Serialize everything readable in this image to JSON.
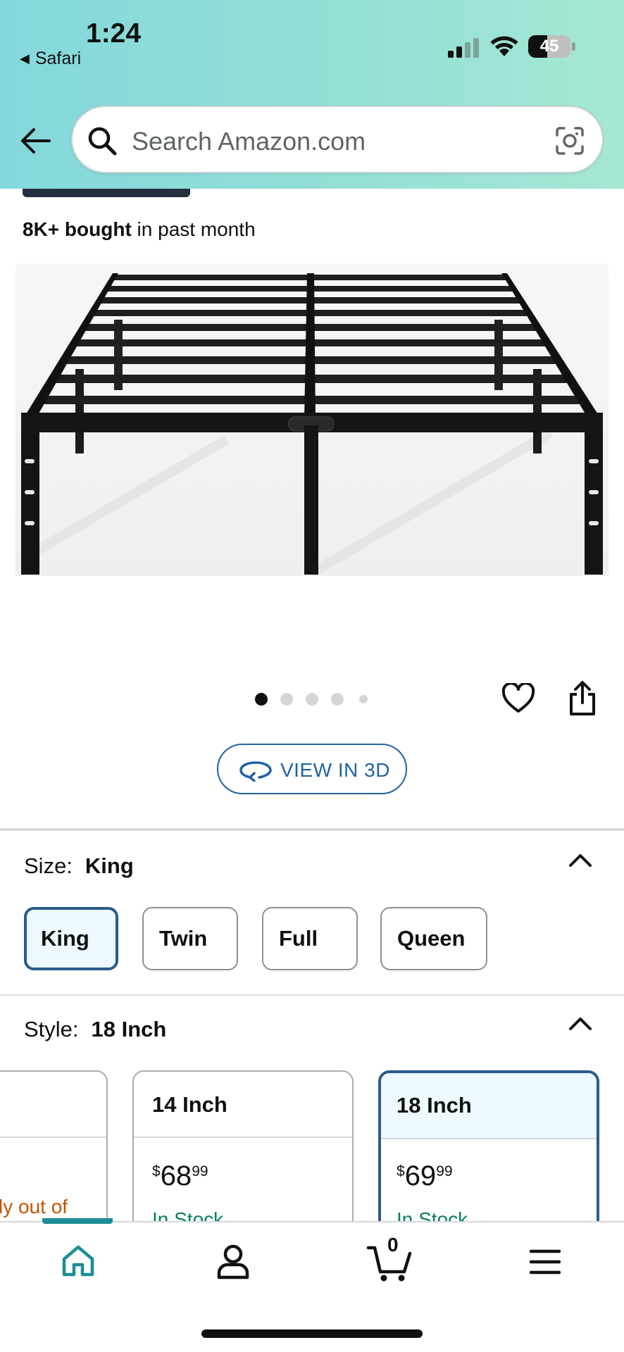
{
  "status_bar": {
    "time": "1:24",
    "back_app": "Safari",
    "battery": "45"
  },
  "search": {
    "placeholder": "Search Amazon.com"
  },
  "product": {
    "bought_bold": "8K+ bought",
    "bought_rest": " in past month",
    "image_count": 5,
    "active_image": 1
  },
  "view3d": {
    "label": "VIEW IN 3D"
  },
  "size": {
    "label": "Size:",
    "selected": "King",
    "options": [
      "King",
      "Twin",
      "Full",
      "Queen"
    ]
  },
  "style": {
    "label": "Style:",
    "selected": "18 Inch",
    "partial_card_text": "ly out of",
    "cards": [
      {
        "name": "14 Inch",
        "price_symbol": "$",
        "price_whole": "68",
        "price_cents": "99",
        "stock": "In Stock"
      },
      {
        "name": "18 Inch",
        "price_symbol": "$",
        "price_whole": "69",
        "price_cents": "99",
        "stock": "In Stock"
      }
    ]
  },
  "tabbar": {
    "items": [
      "home-icon",
      "account-icon",
      "cart-icon",
      "menu-icon"
    ],
    "cart_count": "0",
    "accent_color": "#1c8d96"
  },
  "colors": {
    "link_blue": "#2162a1",
    "in_stock_green": "#067d62",
    "selected_border": "#2b5b8a",
    "warning_orange": "#c45500"
  }
}
